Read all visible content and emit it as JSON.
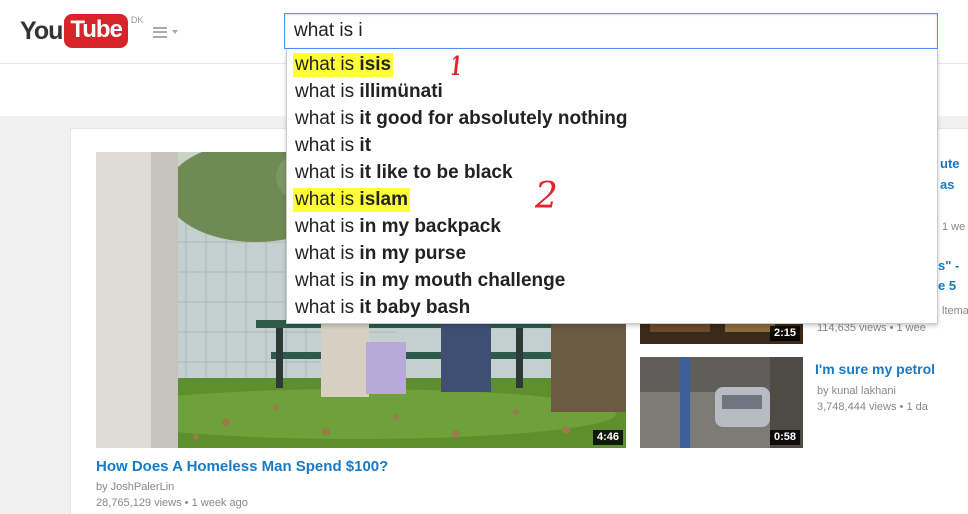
{
  "header": {
    "logo_you": "You",
    "logo_tube": "Tube",
    "logo_country": "DK",
    "search_value": "what is i"
  },
  "suggestions": [
    {
      "prefix": "what is ",
      "bold": "isis",
      "highlighted": true
    },
    {
      "prefix": "what is ",
      "bold": "illimünati",
      "highlighted": false
    },
    {
      "prefix": "what is ",
      "bold": "it good for absolutely nothing",
      "highlighted": false
    },
    {
      "prefix": "what is ",
      "bold": "it",
      "highlighted": false
    },
    {
      "prefix": "what is ",
      "bold": "it like to be black",
      "highlighted": false
    },
    {
      "prefix": "what is ",
      "bold": "islam",
      "highlighted": true
    },
    {
      "prefix": "what is ",
      "bold": "in my backpack",
      "highlighted": false
    },
    {
      "prefix": "what is ",
      "bold": "in my purse",
      "highlighted": false
    },
    {
      "prefix": "what is ",
      "bold": "in my mouth challenge",
      "highlighted": false
    },
    {
      "prefix": "what is ",
      "bold": "it baby bash",
      "highlighted": false
    }
  ],
  "annotations": {
    "mark_1": "1",
    "mark_2": "2"
  },
  "main_video": {
    "title": "How Does A Homeless Man Spend $100?",
    "channel": "by JoshPalerLin",
    "meta": "28,765,129 views • 1 week ago",
    "duration": "4:46"
  },
  "side_videos": [
    {
      "title_frags": [
        "ute",
        "as"
      ],
      "gray_frags": [
        "1 we"
      ],
      "title_frags_b": [
        "s\" -",
        "e 5"
      ],
      "gray_frags_b": [
        "ltema"
      ],
      "meta": "114,635 views • 1 wee",
      "duration": "2:15"
    },
    {
      "title": "I'm sure my petrol",
      "channel": "by kunal lakhani",
      "meta": "3,748,444 views • 1 da",
      "duration": "0:58"
    }
  ],
  "colors": {
    "highlight": "#ffff38",
    "annotation_red": "#e8222a",
    "link_blue": "#167ac6",
    "brand_red": "#d8232a"
  }
}
